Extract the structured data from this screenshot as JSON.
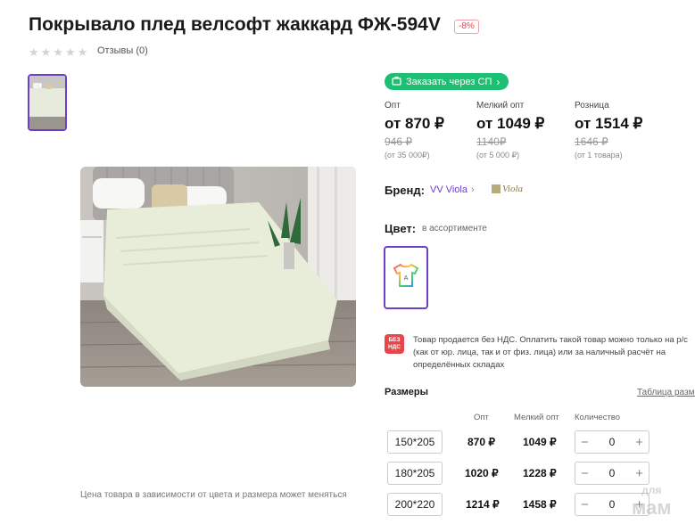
{
  "product": {
    "title": "Покрывало плед велсофт жаккард ФЖ-594V",
    "discount_badge": "-8%",
    "reviews_label": "Отзывы (0)",
    "stars_count": 5
  },
  "gallery": {
    "caption": "Цена товара в зависимости от цвета и размера может меняться"
  },
  "order_button": {
    "label": "Заказать через СП",
    "color": "#1dbf73"
  },
  "prices": [
    {
      "label": "Опт",
      "price": "от 870 ₽",
      "old": "946 ₽",
      "min": "(от 35 000₽)"
    },
    {
      "label": "Мелкий опт",
      "price": "от 1049 ₽",
      "old": "1140₽",
      "min": "(от 5 000 ₽)"
    },
    {
      "label": "Розница",
      "price": "от 1514 ₽",
      "old": "1646 ₽",
      "min": "(от 1 товара)"
    }
  ],
  "brand": {
    "label": "Бренд:",
    "name": "VV Viola",
    "logo_text": "Viola"
  },
  "color": {
    "label": "Цвет:",
    "value": "в ассортименте"
  },
  "nds": {
    "icon_text_1": "БЕЗ",
    "icon_text_2": "НДС",
    "text": "Товар продается без НДС. Оплатить такой товар можно только на р/с (как от юр. лица, так и от физ. лица) или за наличный расчёт на определённых складах"
  },
  "sizes": {
    "label": "Размеры",
    "table_link": "Таблица размеров",
    "headers": {
      "opt": "Опт",
      "small_opt": "Мелкий опт",
      "qty": "Количество"
    },
    "rows": [
      {
        "size": "150*205",
        "opt": "870 ₽",
        "small_opt": "1049 ₽",
        "qty": "0"
      },
      {
        "size": "180*205",
        "opt": "1020 ₽",
        "small_opt": "1228 ₽",
        "qty": "0"
      },
      {
        "size": "200*220",
        "opt": "1214 ₽",
        "small_opt": "1458 ₽",
        "qty": "0"
      }
    ]
  },
  "watermark": {
    "line1": "для",
    "line2": "мам"
  },
  "colors": {
    "accent": "#6b3fc8",
    "green": "#1dbf73",
    "red": "#e5474d"
  }
}
